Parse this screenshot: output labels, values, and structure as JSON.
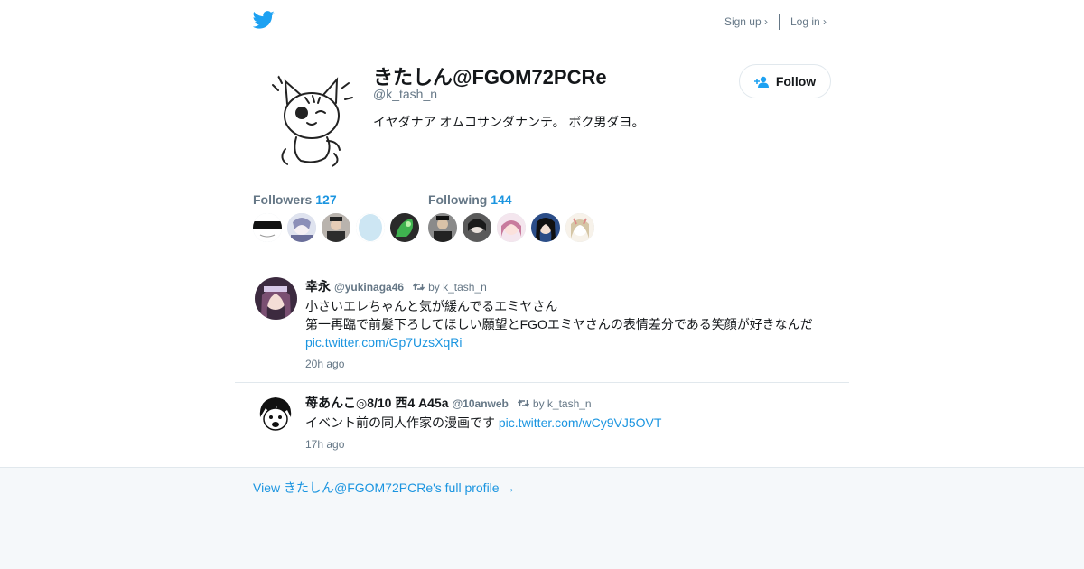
{
  "header": {
    "logo_icon": "twitter-bird-icon",
    "brand_color": "#1da1f2",
    "signup_label": "Sign up ›",
    "login_label": "Log in ›"
  },
  "profile": {
    "display_name": "きたしん@FGOM72PCRe",
    "screen_name": "@k_tash_n",
    "bio": "イヤダナア オムコサンダナンテ。 ボク男ダヨ。",
    "follow_label": "Follow",
    "follow_icon": "add-user-icon"
  },
  "stats": {
    "followers_label": "Followers",
    "followers_count": "127",
    "following_label": "Following",
    "following_count": "144"
  },
  "tweets": [
    {
      "name": "幸永",
      "handle": "@yukinaga46",
      "retweet_by": "by k_tash_n",
      "line1": "小さいエレちゃんと気が緩んでるエミヤさん",
      "line2": "第一再臨で前髪下ろしてほしい願望とFGOエミヤさんの表情差分である笑顔が好きなんだ",
      "link": "pic.twitter.com/Gp7UzsXqRi",
      "time": "20h ago"
    },
    {
      "name": "苺あんこ◎8/10 西4 A45a",
      "handle": "@10anweb",
      "retweet_by": "by k_tash_n",
      "line1": "イベント前の同人作家の漫画です",
      "link": "pic.twitter.com/wCy9VJ5OVT",
      "time": "17h ago"
    }
  ],
  "footer": {
    "full_profile_label": "View きたしん@FGOM72PCRe's full profile →"
  },
  "colors": {
    "link": "#1b95e0",
    "muted": "#657786",
    "border": "#e1e8ed",
    "background": "#f5f8fa"
  }
}
